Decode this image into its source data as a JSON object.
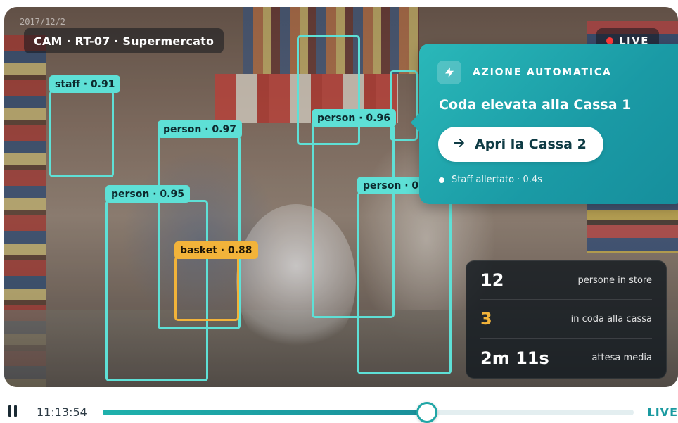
{
  "video": {
    "timestamp_overlay": "2017/12/2",
    "camera_label": "CAM · RT-07 · Supermercato",
    "live_badge": "LIVE"
  },
  "detections": [
    {
      "label": "staff · 0.91",
      "class": "staff",
      "confidence": 0.91
    },
    {
      "label": "person · 0.97",
      "class": "person",
      "confidence": 0.97
    },
    {
      "label": "person · 0.96",
      "class": "person",
      "confidence": 0.96
    },
    {
      "label": "person · 0.95",
      "class": "person",
      "confidence": 0.95
    },
    {
      "label": "person · 0.9",
      "class": "person"
    },
    {
      "label": "basket · 0.88",
      "class": "basket",
      "confidence": 0.88
    }
  ],
  "action_panel": {
    "icon": "bolt-icon",
    "kicker": "AZIONE AUTOMATICA",
    "title": "Coda elevata alla Cassa 1",
    "button_icon": "arrow-right-icon",
    "button_label": "Apri la Cassa 2",
    "status": "Staff allertato · 0.4s"
  },
  "stats": [
    {
      "value": "12",
      "label": "persone in store",
      "accent": false
    },
    {
      "value": "3",
      "label": "in coda alla cassa",
      "accent": true
    },
    {
      "value": "2m 11s",
      "label": "attesa media",
      "accent": false
    }
  ],
  "playback": {
    "state": "playing",
    "time": "11:13:54",
    "progress": 0.61,
    "live_label": "LIVE"
  },
  "colors": {
    "detection_box": "#5ee0d6",
    "basket_box": "#f2b33a",
    "accent_teal": "#1fa6a6",
    "live_dot": "#ff3b3b"
  }
}
